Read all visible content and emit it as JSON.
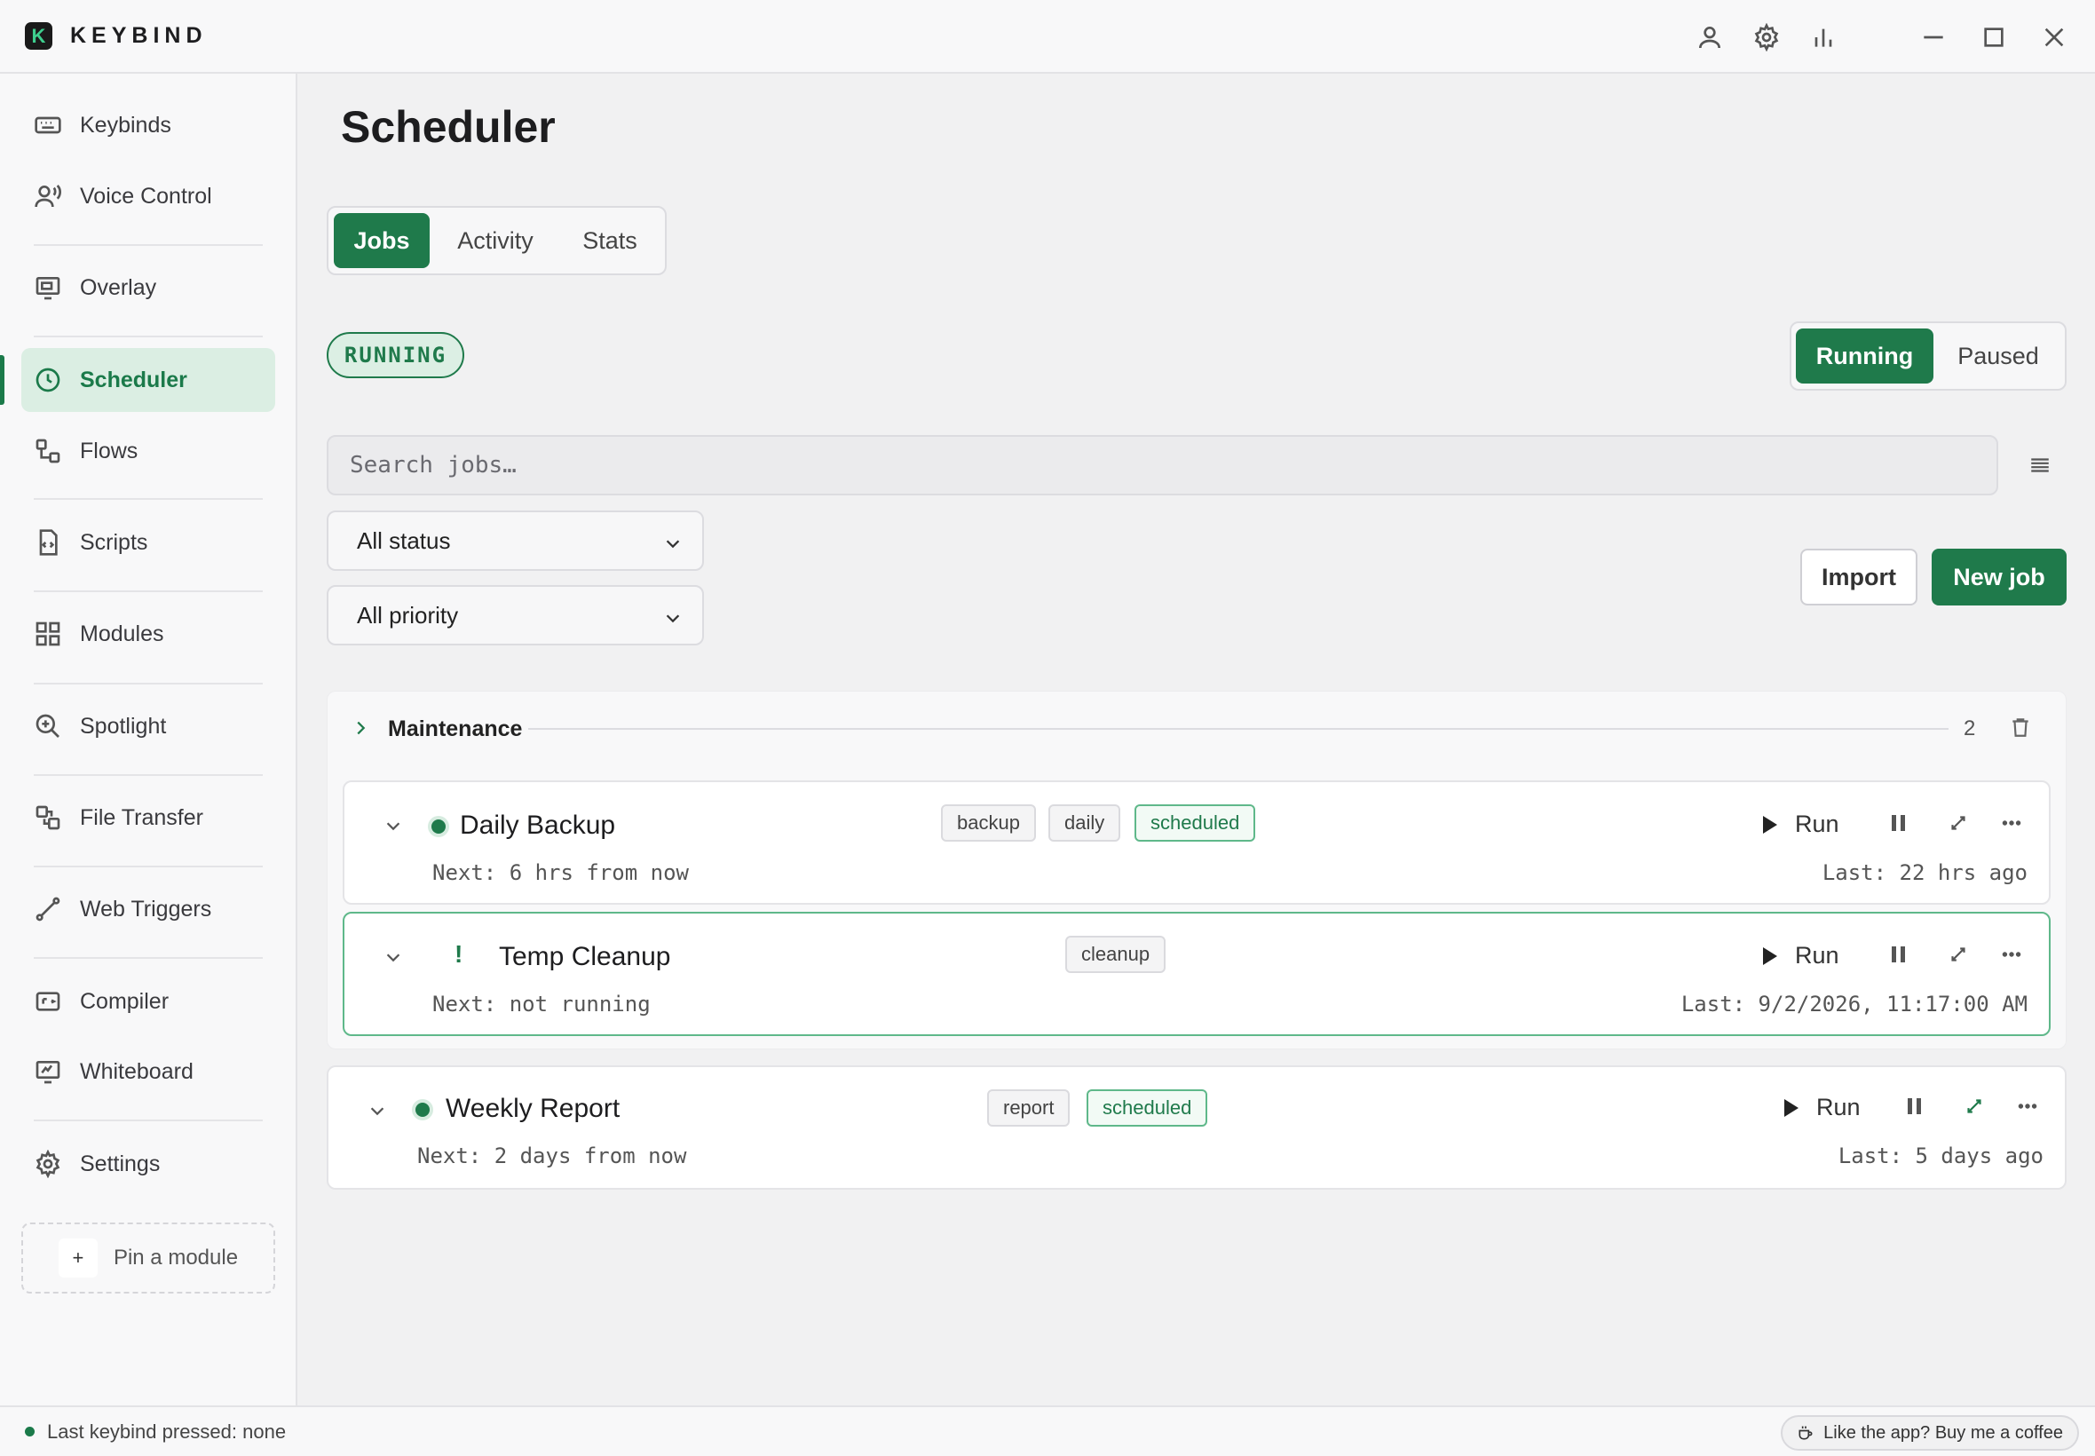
{
  "app": {
    "logo_letter": "K",
    "name": "KEYBIND"
  },
  "titlebar": {
    "icons": [
      "user-icon",
      "gear-icon",
      "bar-chart-icon",
      "minimize-icon",
      "maximize-icon",
      "close-icon"
    ]
  },
  "sidebar": {
    "items": [
      {
        "label": "Keybinds",
        "icon": "keyboard-icon"
      },
      {
        "label": "Voice Control",
        "icon": "voice-icon"
      },
      {
        "label": "Overlay",
        "icon": "monitor-icon"
      },
      {
        "label": "Scheduler",
        "icon": "clock-icon",
        "active": true
      },
      {
        "label": "Flows",
        "icon": "flow-icon"
      },
      {
        "label": "Scripts",
        "icon": "script-file-icon"
      },
      {
        "label": "Modules",
        "icon": "grid-icon"
      },
      {
        "label": "Spotlight",
        "icon": "search-zoom-icon"
      },
      {
        "label": "File Transfer",
        "icon": "file-transfer-icon"
      },
      {
        "label": "Web Triggers",
        "icon": "webhook-icon"
      },
      {
        "label": "Compiler",
        "icon": "compiler-icon"
      },
      {
        "label": "Whiteboard",
        "icon": "whiteboard-icon"
      },
      {
        "label": "Settings",
        "icon": "gear-icon"
      }
    ],
    "pin_plus": "+",
    "pin_label": "Pin a module"
  },
  "main": {
    "title": "Scheduler",
    "tabs": [
      {
        "label": "Jobs",
        "active": true
      },
      {
        "label": "Activity"
      },
      {
        "label": "Stats"
      }
    ],
    "state_pill": "RUNNING",
    "state_toggle": [
      {
        "label": "Running",
        "active": true
      },
      {
        "label": "Paused"
      }
    ],
    "search_placeholder": "Search jobs…",
    "filters": {
      "status": "All status",
      "priority": "All priority"
    },
    "import_label": "Import",
    "new_job_label": "New job"
  },
  "group": {
    "name": "Maintenance",
    "count": "2",
    "jobs": [
      {
        "name": "Daily Backup",
        "status": "active",
        "tags": [
          "backup",
          "daily",
          "scheduled"
        ],
        "next": "Next: 6 hrs from now",
        "last": "Last: 22 hrs ago",
        "run_label": "Run"
      },
      {
        "name": "Temp Cleanup",
        "status": "warning",
        "warn_glyph": "!",
        "tags": [
          "cleanup"
        ],
        "next": "Next: not running",
        "last": "Last: 9/2/2026, 11:17:00 AM",
        "run_label": "Run"
      }
    ]
  },
  "ungrouped_jobs": [
    {
      "name": "Weekly Report",
      "status": "active",
      "tags": [
        "report",
        "scheduled"
      ],
      "next": "Next: 2 days from now",
      "last": "Last: 5 days ago",
      "run_label": "Run"
    }
  ],
  "statusbar": {
    "text": "Last keybind pressed: none",
    "coffee_label": "Like the app? Buy me a coffee"
  },
  "colors": {
    "accent": "#1f7a4b",
    "accent_light": "#dcefe4",
    "background": "#f1f1f2"
  }
}
